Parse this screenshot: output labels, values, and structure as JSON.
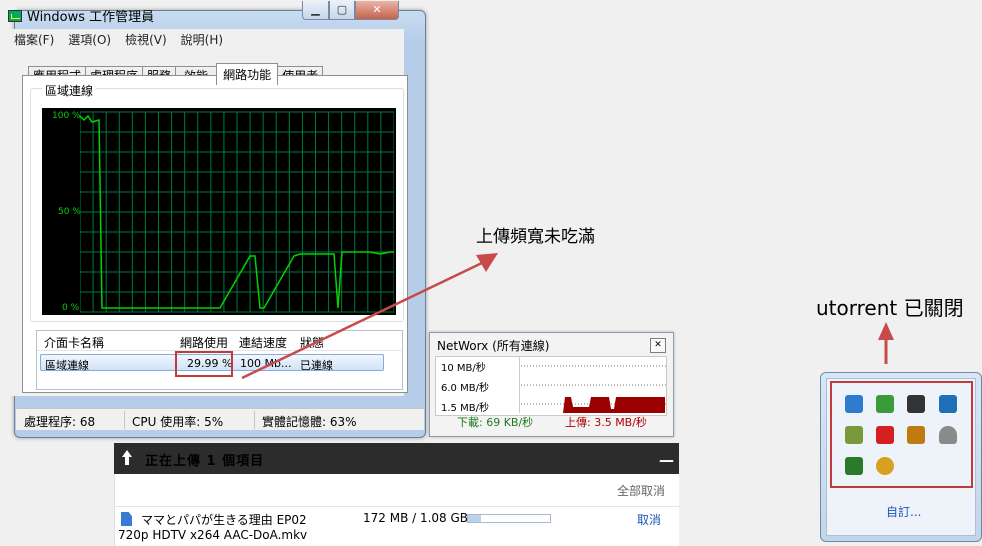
{
  "task_manager": {
    "title": "Windows 工作管理員",
    "menu": [
      "檔案(F)",
      "選項(O)",
      "檢視(V)",
      "說明(H)"
    ],
    "tabs": [
      "應用程式",
      "處理程序",
      "服務",
      "效能",
      "網路功能",
      "使用者"
    ],
    "active_tab": "網路功能",
    "graph_title": "區域連線",
    "graph_y_labels": [
      "100 %",
      "50 %",
      "0 %"
    ],
    "list_headers": [
      "介面卡名稱",
      "網路使用",
      "連結速度",
      "狀態"
    ],
    "row": {
      "name": "區域連線",
      "usage": "29.99 %",
      "speed": "100 Mb...",
      "state": "已連線"
    },
    "status": {
      "processes": "處理程序: 68",
      "cpu": "CPU 使用率: 5%",
      "memory": "實體記憶體: 63%"
    },
    "graph_series_percent": [
      98,
      96,
      98,
      95,
      96,
      2,
      2,
      2,
      2,
      2,
      2,
      2,
      28,
      28,
      2,
      2,
      28,
      29,
      29,
      29,
      29,
      29,
      2,
      30,
      30,
      30,
      30,
      29,
      30,
      30,
      30,
      30,
      29,
      30
    ]
  },
  "annotation": {
    "text": "上傳頻寬未吃滿"
  },
  "networx": {
    "title": "NetWorx (所有連線)",
    "y_labels": [
      "10 MB/秒",
      "6.0 MB/秒",
      "1.5 MB/秒"
    ],
    "download": "下載: 69 KB/秒",
    "upload": "上傳: 3.5 MB/秒"
  },
  "upload_panel": {
    "title": "正在上傳 1 個項目",
    "minimize": "—",
    "cancel_all": "全部取消",
    "file_line1": "ママとパパが生きる理由 EP02",
    "file_line2": "720p HDTV x264 AAC-DoA.mkv",
    "size": "172 MB / 1.08 GB",
    "progress_fraction": 0.16,
    "cancel": "取消"
  },
  "tray": {
    "annotation": "utorrent 已關閉",
    "customize": "自訂...",
    "icons": [
      "network-icon",
      "usb-safe-remove-icon",
      "speaker-icon",
      "network-tool-icon",
      "check-drive-icon",
      "antivirus-icon",
      "meter-icon",
      "notification-bell-icon",
      "green-app-icon",
      "palette-icon"
    ],
    "icon_colors": [
      "#2f7bd0",
      "#3a9b3a",
      "#333333",
      "#1f6fb8",
      "#7a9a3a",
      "#d42020",
      "#c07a10",
      "#8a8a8a",
      "#2a7a2a",
      "#d8a020"
    ]
  },
  "colors": {
    "accent_red": "#c33a3a",
    "graph_green": "#00d400",
    "grid_green": "#007a3d"
  }
}
